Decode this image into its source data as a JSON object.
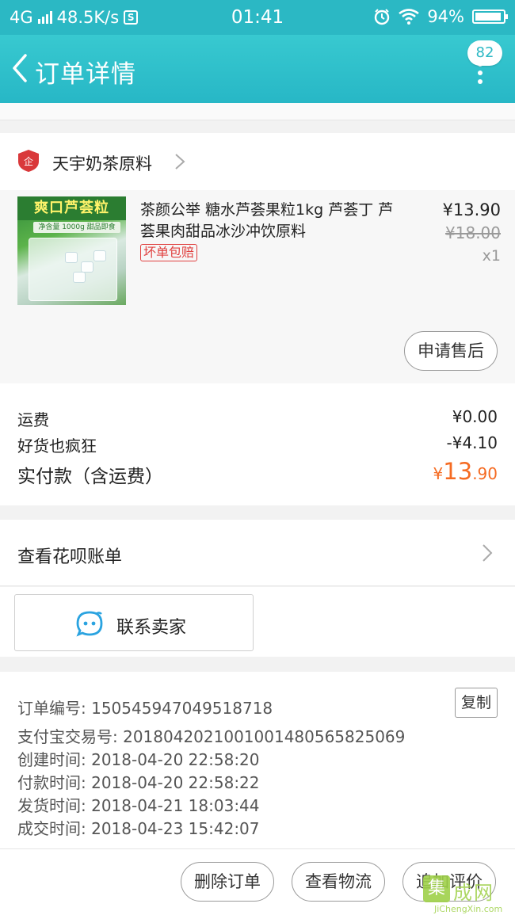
{
  "status_bar": {
    "network": "4G",
    "speed": "48.5K/s",
    "s_icon": "S",
    "time": "01:41",
    "battery": "94%",
    "battery_level": 0.94
  },
  "header": {
    "title": "订单详情",
    "badge": "82"
  },
  "store": {
    "logo_text": "企",
    "name": "天宇奶茶原料"
  },
  "product": {
    "image_banner": "爽口芦荟粒",
    "image_sub": "净含量 1000g 甜品即食",
    "title": "茶颜公举 糖水芦荟果粒1kg 芦荟丁 芦荟果肉甜品冰沙冲饮原料",
    "tag": "坏单包赔",
    "price": "¥13.90",
    "original_price": "¥18.00",
    "quantity": "x1",
    "after_sale_label": "申请售后"
  },
  "fees": {
    "shipping_label": "运费",
    "shipping_value": "¥0.00",
    "discount_label": "好货也疯狂",
    "discount_value": "-¥4.10",
    "total_label": "实付款（含运费）",
    "total_currency": "¥",
    "total_int": "13",
    "total_dec": ".90"
  },
  "huabei": {
    "label": "查看花呗账单"
  },
  "contact": {
    "label": "联系卖家"
  },
  "order_info": {
    "order_no": "订单编号: 150545947049518718",
    "copy_label": "复制",
    "alipay_no": "支付宝交易号: 2018042021001001480565825069",
    "created": "创建时间: 2018-04-20 22:58:20",
    "paid": "付款时间: 2018-04-20 22:58:22",
    "shipped": "发货时间: 2018-04-21 18:03:44",
    "completed": "成交时间: 2018-04-23 15:42:07"
  },
  "actions": {
    "delete_label": "删除订单",
    "logistics_label": "查看物流",
    "review_label": "追加评价"
  },
  "watermark": {
    "logo": "集",
    "text": "成网",
    "sub": "JiChengXin.com"
  },
  "colors": {
    "accent": "#2bb8c4",
    "price_highlight": "#f56b22",
    "tag_red": "#e0403f"
  },
  "icons": [
    "signal-icon",
    "s-app-icon",
    "alarm-icon",
    "wifi-icon",
    "battery-icon",
    "back-icon",
    "more-icon",
    "store-logo-icon",
    "chevron-right-icon",
    "chat-icon"
  ]
}
